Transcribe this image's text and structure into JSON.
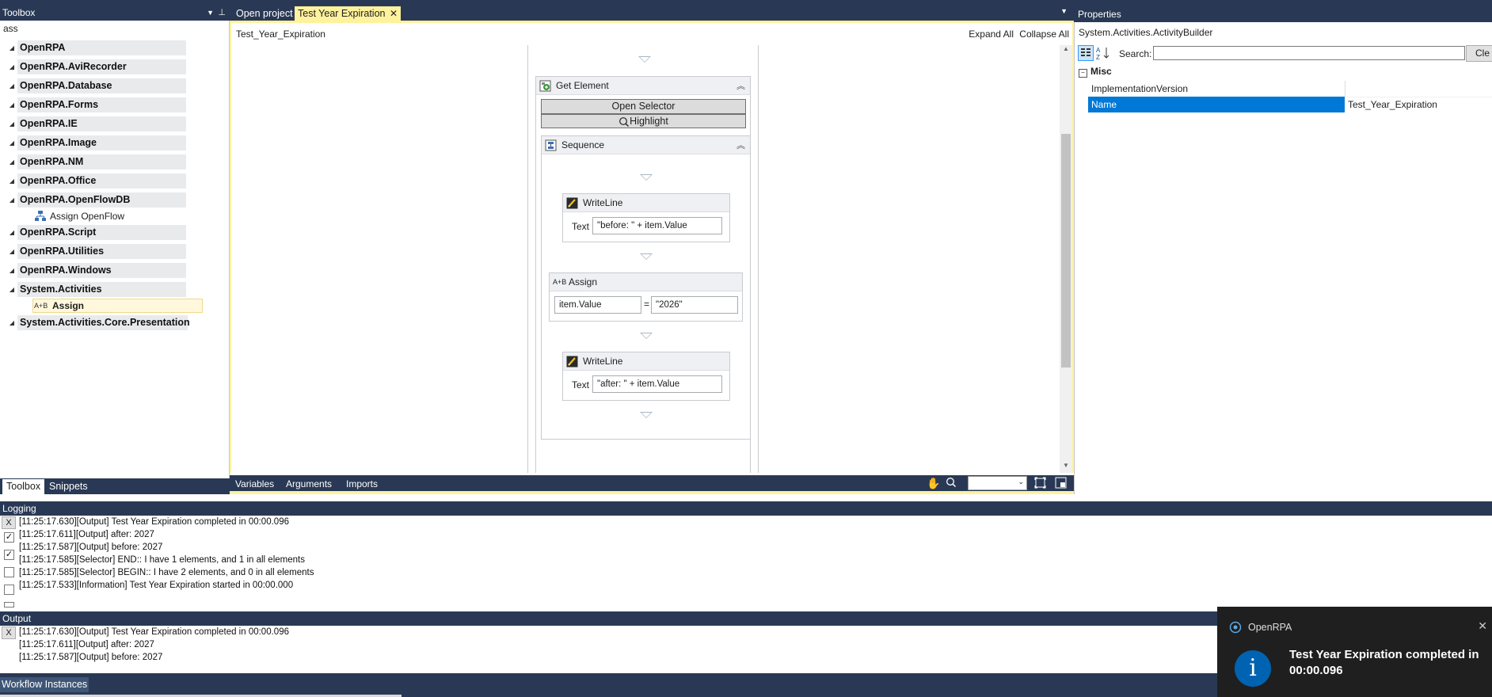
{
  "toolbox": {
    "title": "Toolbox",
    "search_value": "ass",
    "groups": [
      "OpenRPA",
      "OpenRPA.AviRecorder",
      "OpenRPA.Database",
      "OpenRPA.Forms",
      "OpenRPA.IE",
      "OpenRPA.Image",
      "OpenRPA.NM",
      "OpenRPA.Office",
      "OpenRPA.OpenFlowDB",
      "OpenRPA.Script",
      "OpenRPA.Utilities",
      "OpenRPA.Windows",
      "System.Activities",
      "System.Activities.Core.Presentation"
    ],
    "openflow_item": "Assign OpenFlow",
    "assign_item": "Assign",
    "assign_icon_text": "A+B",
    "bottom_tabs": [
      "Toolbox",
      "Snippets"
    ]
  },
  "tabs": {
    "open_project": "Open project",
    "active": "Test Year Expiration"
  },
  "designer": {
    "breadcrumb": "Test_Year_Expiration",
    "expand_all": "Expand All",
    "collapse_all": "Collapse All",
    "get_element": {
      "title": "Get Element",
      "open_selector": "Open Selector",
      "highlight": "Highlight"
    },
    "sequence": {
      "title": "Sequence"
    },
    "writeline1": {
      "title": "WriteLine",
      "text_label": "Text",
      "value": "\"before: \" + item.Value"
    },
    "assign": {
      "title": "Assign",
      "to": "item.Value",
      "eq": "=",
      "value": "\"2026\""
    },
    "writeline2": {
      "title": "WriteLine",
      "text_label": "Text",
      "value": "\"after: \" + item.Value"
    },
    "bottom_tabs": [
      "Variables",
      "Arguments",
      "Imports"
    ]
  },
  "properties": {
    "title": "Properties",
    "type_name": "System.Activities.ActivityBuilder",
    "search_label": "Search:",
    "clear_label": "Cle",
    "category": "Misc",
    "rows": [
      {
        "name": "ImplementationVersion",
        "value": ""
      },
      {
        "name": "Name",
        "value": "Test_Year_Expiration"
      }
    ]
  },
  "logging": {
    "title": "Logging",
    "clear": "X",
    "lines": [
      "[11:25:17.630][Output] Test Year Expiration completed in 00:00.096",
      "[11:25:17.611][Output] after: 2027",
      "[11:25:17.587][Output] before: 2027",
      "[11:25:17.585][Selector] END:: I have 1 elements, and 1 in all elements",
      "[11:25:17.585][Selector] BEGIN:: I have 2 elements, and 0 in all elements",
      "[11:25:17.533][Information] Test Year Expiration started in 00:00.000"
    ]
  },
  "output": {
    "title": "Output",
    "clear": "X",
    "lines": [
      "[11:25:17.630][Output] Test Year Expiration completed in 00:00.096",
      "[11:25:17.611][Output] after: 2027",
      "[11:25:17.587][Output] before: 2027"
    ]
  },
  "workflow_instances": {
    "title": "Workflow Instances"
  },
  "toast": {
    "app_name": "OpenRPA",
    "message": "Test Year Expiration completed in 00:00.096",
    "icon_text": "i"
  },
  "colors": {
    "navy": "#293955",
    "accent_yellow": "#fff29d",
    "selection_blue": "#0078d7",
    "toast_bg": "#1f1f1f"
  }
}
